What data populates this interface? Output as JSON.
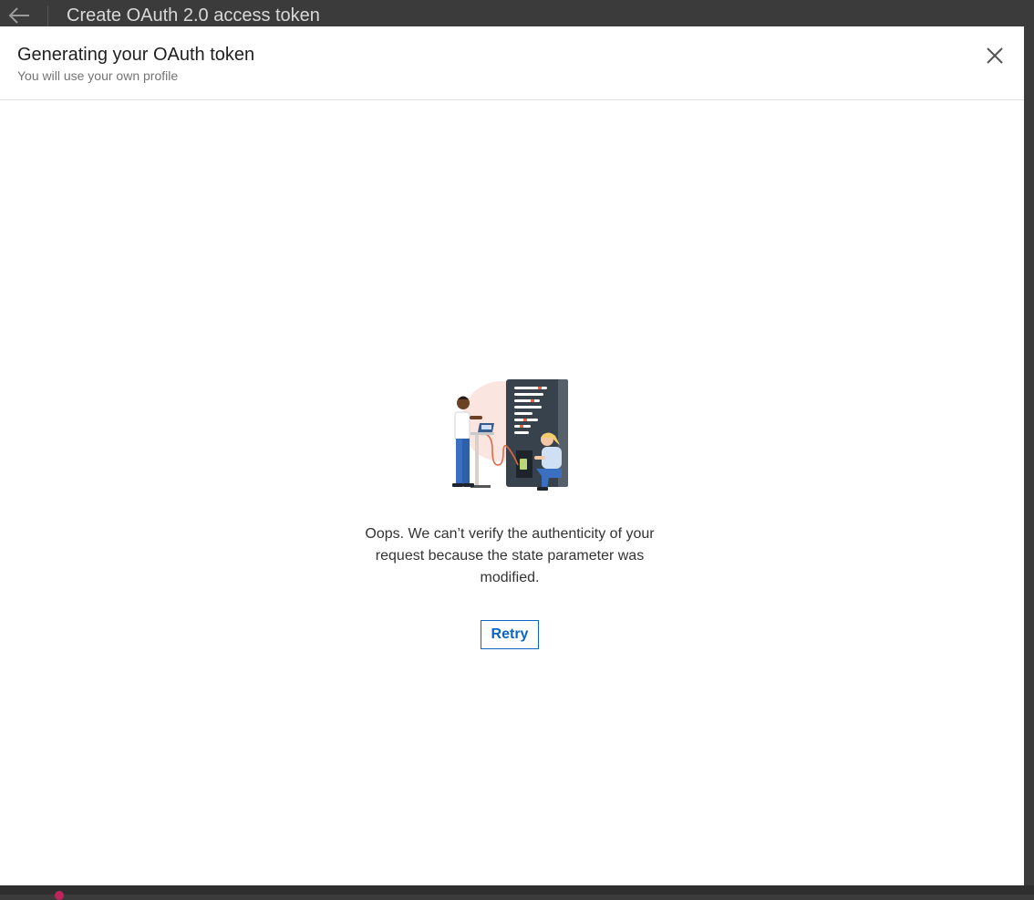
{
  "window": {
    "title": "Create OAuth 2.0 access token",
    "back_icon": "arrow-left-icon"
  },
  "modal": {
    "title": "Generating your OAuth token",
    "subtitle": "You will use your own profile",
    "close_icon": "close-icon",
    "illustration": "server-room-technicians-illustration",
    "message": "Oops. We can’t verify the authenticity of your request because the state parameter was modified.",
    "retry_label": "Retry"
  },
  "colors": {
    "accent": "#0a66c2",
    "overlay": "#3b3b3b",
    "bottom_indicator": "#c0245c"
  }
}
